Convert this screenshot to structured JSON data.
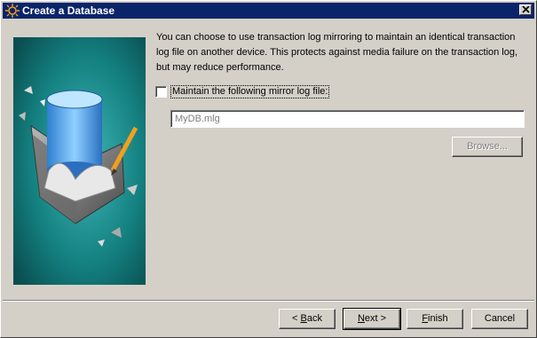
{
  "window": {
    "title": "Create a Database",
    "icon": "sybase-sun-icon",
    "close_icon": "close-icon"
  },
  "description": "You can choose to use transaction log mirroring to maintain an identical transaction log file on another device. This protects against media failure on the transaction log, but may reduce performance.",
  "mirror": {
    "checkbox_label": "Maintain the following mirror log file:",
    "checked": false,
    "file_value": "MyDB.mlg",
    "browse_label": "Browse..."
  },
  "buttons": {
    "back_prefix": "< ",
    "back_mnemonic": "B",
    "back_rest": "ack",
    "next_mnemonic": "N",
    "next_rest": "ext >",
    "finish_mnemonic": "F",
    "finish_rest": "inish",
    "cancel_label": "Cancel"
  },
  "colors": {
    "title_bar": "#0a246a",
    "face": "#d4d0c8",
    "illustration_bg": "#0e6e6e"
  }
}
